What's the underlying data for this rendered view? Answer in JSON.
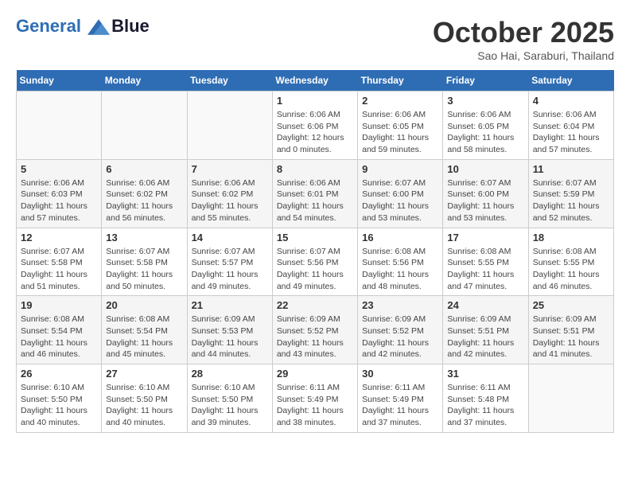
{
  "header": {
    "logo_line1": "General",
    "logo_line2": "Blue",
    "month": "October 2025",
    "location": "Sao Hai, Saraburi, Thailand"
  },
  "weekdays": [
    "Sunday",
    "Monday",
    "Tuesday",
    "Wednesday",
    "Thursday",
    "Friday",
    "Saturday"
  ],
  "weeks": [
    [
      {
        "day": "",
        "info": ""
      },
      {
        "day": "",
        "info": ""
      },
      {
        "day": "",
        "info": ""
      },
      {
        "day": "1",
        "info": "Sunrise: 6:06 AM\nSunset: 6:06 PM\nDaylight: 12 hours\nand 0 minutes."
      },
      {
        "day": "2",
        "info": "Sunrise: 6:06 AM\nSunset: 6:05 PM\nDaylight: 11 hours\nand 59 minutes."
      },
      {
        "day": "3",
        "info": "Sunrise: 6:06 AM\nSunset: 6:05 PM\nDaylight: 11 hours\nand 58 minutes."
      },
      {
        "day": "4",
        "info": "Sunrise: 6:06 AM\nSunset: 6:04 PM\nDaylight: 11 hours\nand 57 minutes."
      }
    ],
    [
      {
        "day": "5",
        "info": "Sunrise: 6:06 AM\nSunset: 6:03 PM\nDaylight: 11 hours\nand 57 minutes."
      },
      {
        "day": "6",
        "info": "Sunrise: 6:06 AM\nSunset: 6:02 PM\nDaylight: 11 hours\nand 56 minutes."
      },
      {
        "day": "7",
        "info": "Sunrise: 6:06 AM\nSunset: 6:02 PM\nDaylight: 11 hours\nand 55 minutes."
      },
      {
        "day": "8",
        "info": "Sunrise: 6:06 AM\nSunset: 6:01 PM\nDaylight: 11 hours\nand 54 minutes."
      },
      {
        "day": "9",
        "info": "Sunrise: 6:07 AM\nSunset: 6:00 PM\nDaylight: 11 hours\nand 53 minutes."
      },
      {
        "day": "10",
        "info": "Sunrise: 6:07 AM\nSunset: 6:00 PM\nDaylight: 11 hours\nand 53 minutes."
      },
      {
        "day": "11",
        "info": "Sunrise: 6:07 AM\nSunset: 5:59 PM\nDaylight: 11 hours\nand 52 minutes."
      }
    ],
    [
      {
        "day": "12",
        "info": "Sunrise: 6:07 AM\nSunset: 5:58 PM\nDaylight: 11 hours\nand 51 minutes."
      },
      {
        "day": "13",
        "info": "Sunrise: 6:07 AM\nSunset: 5:58 PM\nDaylight: 11 hours\nand 50 minutes."
      },
      {
        "day": "14",
        "info": "Sunrise: 6:07 AM\nSunset: 5:57 PM\nDaylight: 11 hours\nand 49 minutes."
      },
      {
        "day": "15",
        "info": "Sunrise: 6:07 AM\nSunset: 5:56 PM\nDaylight: 11 hours\nand 49 minutes."
      },
      {
        "day": "16",
        "info": "Sunrise: 6:08 AM\nSunset: 5:56 PM\nDaylight: 11 hours\nand 48 minutes."
      },
      {
        "day": "17",
        "info": "Sunrise: 6:08 AM\nSunset: 5:55 PM\nDaylight: 11 hours\nand 47 minutes."
      },
      {
        "day": "18",
        "info": "Sunrise: 6:08 AM\nSunset: 5:55 PM\nDaylight: 11 hours\nand 46 minutes."
      }
    ],
    [
      {
        "day": "19",
        "info": "Sunrise: 6:08 AM\nSunset: 5:54 PM\nDaylight: 11 hours\nand 46 minutes."
      },
      {
        "day": "20",
        "info": "Sunrise: 6:08 AM\nSunset: 5:54 PM\nDaylight: 11 hours\nand 45 minutes."
      },
      {
        "day": "21",
        "info": "Sunrise: 6:09 AM\nSunset: 5:53 PM\nDaylight: 11 hours\nand 44 minutes."
      },
      {
        "day": "22",
        "info": "Sunrise: 6:09 AM\nSunset: 5:52 PM\nDaylight: 11 hours\nand 43 minutes."
      },
      {
        "day": "23",
        "info": "Sunrise: 6:09 AM\nSunset: 5:52 PM\nDaylight: 11 hours\nand 42 minutes."
      },
      {
        "day": "24",
        "info": "Sunrise: 6:09 AM\nSunset: 5:51 PM\nDaylight: 11 hours\nand 42 minutes."
      },
      {
        "day": "25",
        "info": "Sunrise: 6:09 AM\nSunset: 5:51 PM\nDaylight: 11 hours\nand 41 minutes."
      }
    ],
    [
      {
        "day": "26",
        "info": "Sunrise: 6:10 AM\nSunset: 5:50 PM\nDaylight: 11 hours\nand 40 minutes."
      },
      {
        "day": "27",
        "info": "Sunrise: 6:10 AM\nSunset: 5:50 PM\nDaylight: 11 hours\nand 40 minutes."
      },
      {
        "day": "28",
        "info": "Sunrise: 6:10 AM\nSunset: 5:50 PM\nDaylight: 11 hours\nand 39 minutes."
      },
      {
        "day": "29",
        "info": "Sunrise: 6:11 AM\nSunset: 5:49 PM\nDaylight: 11 hours\nand 38 minutes."
      },
      {
        "day": "30",
        "info": "Sunrise: 6:11 AM\nSunset: 5:49 PM\nDaylight: 11 hours\nand 37 minutes."
      },
      {
        "day": "31",
        "info": "Sunrise: 6:11 AM\nSunset: 5:48 PM\nDaylight: 11 hours\nand 37 minutes."
      },
      {
        "day": "",
        "info": ""
      }
    ]
  ]
}
